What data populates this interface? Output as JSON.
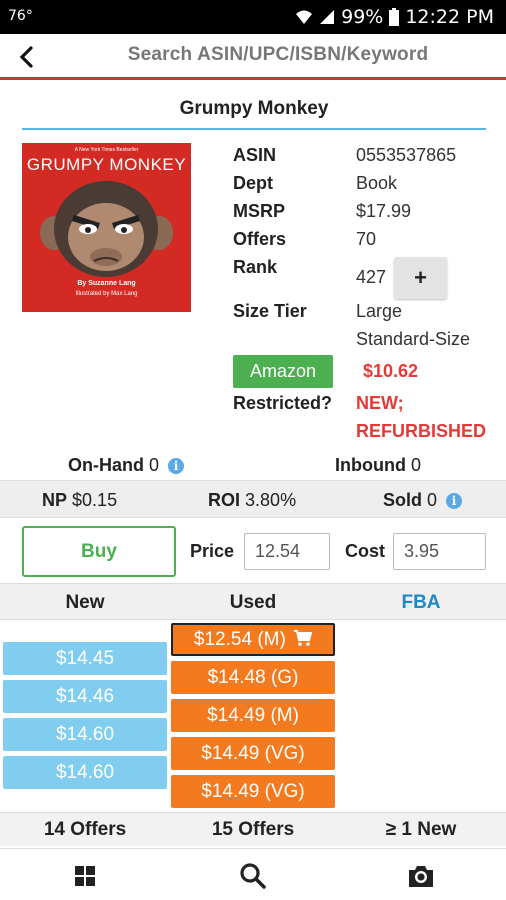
{
  "status": {
    "temperature": "76°",
    "battery": "99%",
    "time": "12:22 PM"
  },
  "search": {
    "placeholder": "Search ASIN/UPC/ISBN/Keyword"
  },
  "product": {
    "title": "Grumpy Monkey",
    "cover": {
      "small": "A New York Times Bestseller",
      "title": "GRUMPY MONKEY",
      "author": "By Suzanne Lang",
      "illustrator": "Illustrated by Max Lang"
    },
    "fields": [
      {
        "label": "ASIN",
        "value": "0553537865"
      },
      {
        "label": "Dept",
        "value": "Book"
      },
      {
        "label": "MSRP",
        "value": "$17.99"
      },
      {
        "label": "Offers",
        "value": "70"
      },
      {
        "label": "Rank",
        "value": "427"
      }
    ],
    "size_tier": {
      "label": "Size Tier",
      "line1": "Large",
      "line2": "Standard-Size"
    },
    "amazon": {
      "label": "Amazon",
      "price": "$10.62"
    },
    "restricted": {
      "label": "Restricted?",
      "line1": "NEW;",
      "line2": "REFURBISHED"
    },
    "plus_label": "+"
  },
  "inventory": {
    "onhand_label": "On-Hand",
    "onhand_value": "0",
    "inbound_label": "Inbound",
    "inbound_value": "0"
  },
  "metrics": {
    "np_label": "NP",
    "np_value": "$0.15",
    "roi_label": "ROI",
    "roi_value": "3.80%",
    "sold_label": "Sold",
    "sold_value": "0"
  },
  "buy": {
    "button": "Buy",
    "price_label": "Price",
    "price_value": "12.54",
    "cost_label": "Cost",
    "cost_value": "3.95"
  },
  "columns": {
    "new": "New",
    "used": "Used",
    "fba": "FBA"
  },
  "new_offers": [
    "$14.45",
    "$14.46",
    "$14.60",
    "$14.60"
  ],
  "used_offers": [
    "$12.54 (M)",
    "$14.48 (G)",
    "$14.49 (M)",
    "$14.49 (VG)",
    "$14.49 (VG)"
  ],
  "footer": {
    "new_count": "14 Offers",
    "used_count": "15 Offers",
    "fba_count": "≥ 1 New"
  },
  "colors": {
    "accent_red": "#d32f2f",
    "new_blue": "#81cdf0",
    "used_orange": "#f47a20",
    "buy_green": "#4caf50",
    "fba_blue": "#1e88c8"
  }
}
